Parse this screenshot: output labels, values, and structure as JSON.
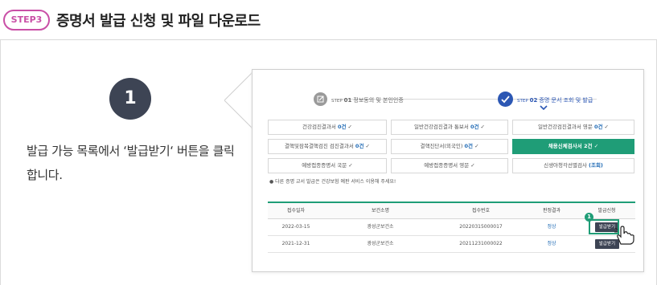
{
  "header": {
    "step_badge": "STEP3",
    "title": "증명서 발급 신청 및 파일 다운로드"
  },
  "instruction": {
    "number": "1",
    "text": "발급 가능 목록에서 ‘발급받기‘ 버튼을 클릭합니다."
  },
  "steps": [
    {
      "prefix": "STEP",
      "num": "01",
      "label": "정보동의 및 본인인증",
      "state": "done",
      "icon": "edit-icon"
    },
    {
      "prefix": "STEP",
      "num": "02",
      "label": "증명 문서 조회 및 발급",
      "state": "current",
      "icon": "check-icon"
    }
  ],
  "documents": [
    {
      "label": "건강검진결과서",
      "count": "0건",
      "selected": false
    },
    {
      "label": "일반건강검진결과 통보서",
      "count": "0건",
      "selected": false
    },
    {
      "label": "일반건강검진결과서 영문",
      "count": "0건",
      "selected": false
    },
    {
      "label": "결핵및잠복결핵검진 검진결과서",
      "count": "0건",
      "selected": false
    },
    {
      "label": "결핵진단서(외국인)",
      "count": "0건",
      "selected": false
    },
    {
      "label": "채용신체검사서",
      "count": "2건",
      "selected": true
    },
    {
      "label": "예방접종증명서 국문",
      "count": "",
      "selected": false
    },
    {
      "label": "예방접종증명서 영문",
      "count": "",
      "selected": false
    },
    {
      "label": "신생아청각선별검사",
      "count": "(조회)",
      "selected": false
    }
  ],
  "note": "● 다른 증명 교서 발급은 건강보험 예판 서비스 이용해 주세요!",
  "table": {
    "headers": [
      "접수일자",
      "보건소명",
      "접수번호",
      "판정결과",
      "발급신청"
    ],
    "rows": [
      {
        "date": "2022-03-15",
        "center": "광성군보건소",
        "receipt": "20220315000017",
        "result": "정상",
        "action": "발급받기"
      },
      {
        "date": "2021-12-31",
        "center": "광성군보건소",
        "receipt": "20211231000022",
        "result": "정상",
        "action": "발급받기"
      }
    ]
  },
  "callout_number": "1",
  "colors": {
    "accent_magenta": "#c94fa6",
    "green": "#1f9d77",
    "navy": "#3d4454",
    "blue": "#1f6ab5"
  }
}
